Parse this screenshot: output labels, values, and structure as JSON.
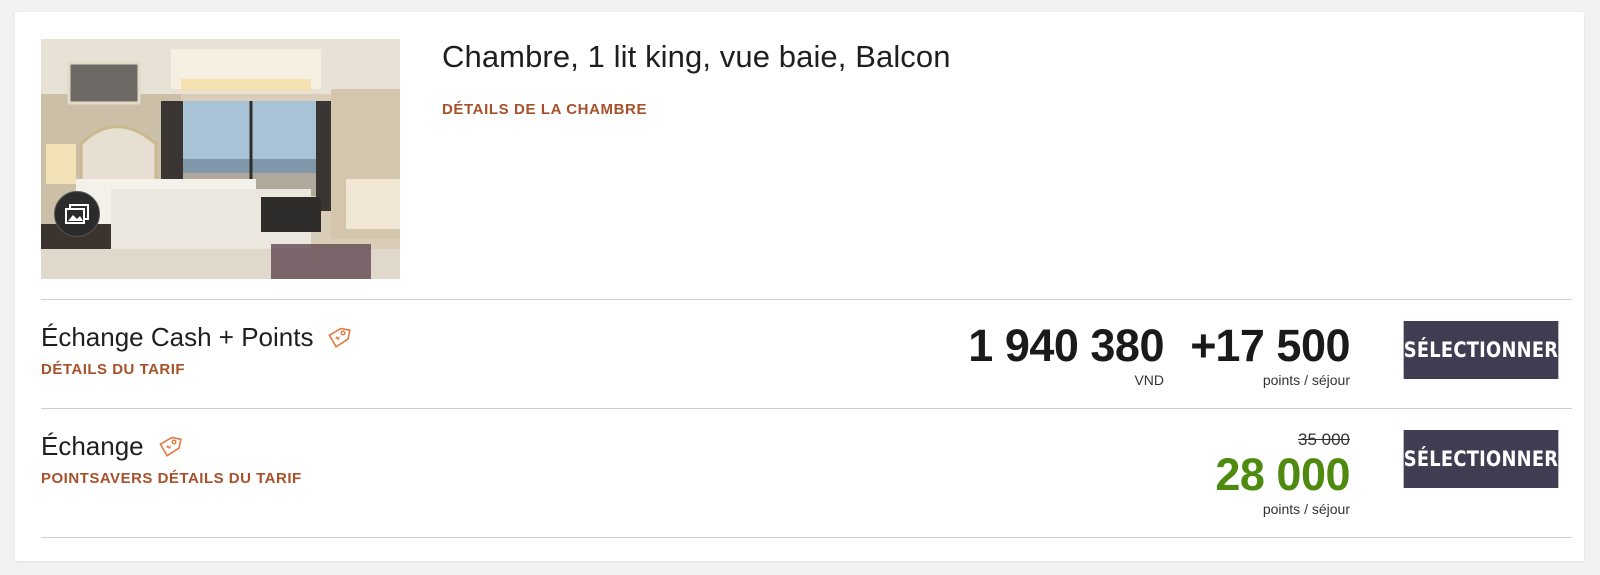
{
  "room": {
    "title": "Chambre, 1 lit king, vue baie, Balcon",
    "details_link": "DÉTAILS DE LA CHAMBRE",
    "photo_icon": "gallery-icon"
  },
  "rates": [
    {
      "name": "Échange Cash + Points",
      "link": "DÉTAILS DU TARIF",
      "cash_amount": "1 940 380",
      "cash_unit": "VND",
      "plus": "+",
      "points_amount": "17 500",
      "points_unit": "points / séjour",
      "button": "SÉLECTIONNER"
    },
    {
      "name": "Échange",
      "link": "POINTSAVERS DÉTAILS DU TARIF",
      "old_points": "35 000",
      "points_amount": "28 000",
      "points_unit": "points / séjour",
      "button": "SÉLECTIONNER"
    }
  ],
  "colors": {
    "accent_link": "#a8502a",
    "button_bg": "#403d52",
    "saver_green": "#4f8a10",
    "tag_orange": "#e07a3f"
  }
}
